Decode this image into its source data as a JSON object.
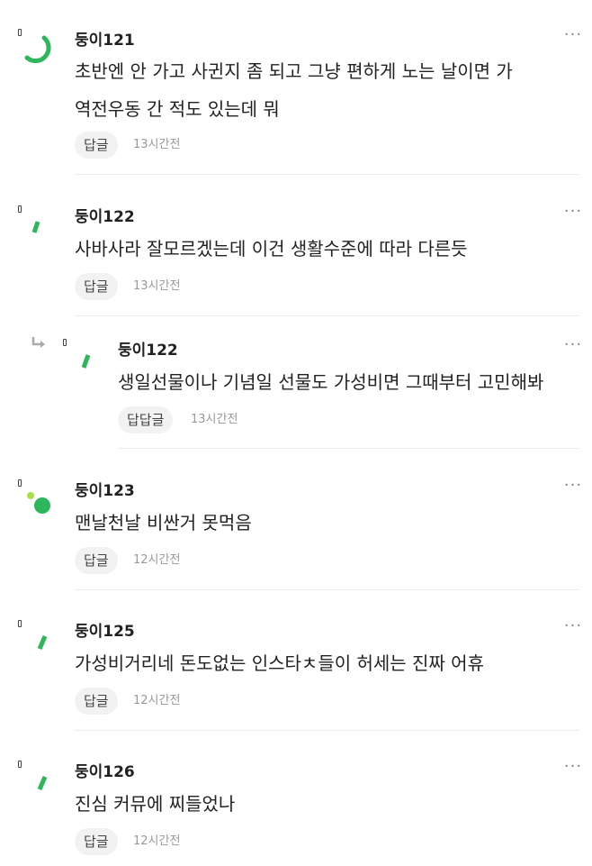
{
  "comments": [
    {
      "author": "둥이121",
      "text_lines": [
        "초반엔 안 가고 사귄지 좀 되고 그냥 편하게 노는 날이면 가",
        "역전우동 간 적도 있는데 뭐"
      ],
      "reply_label": "답글",
      "time": "13시간전",
      "avatar_icon": "green-arc-icon",
      "more_icon": "more-dots-icon"
    },
    {
      "author": "둥이122",
      "text_lines": [
        "사바사라 잘모르겠는데 이건 생활수준에 따라 다른듯"
      ],
      "reply_label": "답글",
      "time": "13시간전",
      "avatar_icon": "green-stroke-icon",
      "more_icon": "more-dots-icon"
    },
    {
      "author": "둥이122",
      "text_lines": [
        "생일선물이나 기념일 선물도 가성비면 그때부터 고민해봐"
      ],
      "reply_label": "답답글",
      "time": "13시간전",
      "avatar_icon": "green-stroke-icon",
      "more_icon": "more-dots-icon",
      "is_reply": true
    },
    {
      "author": "둥이123",
      "text_lines": [
        "맨날천날 비싼거 못먹음"
      ],
      "reply_label": "답글",
      "time": "12시간전",
      "avatar_icon": "green-dots-icon",
      "more_icon": "more-dots-icon"
    },
    {
      "author": "둥이125",
      "text_lines": [
        "가성비거리네 돈도없는 인스타ㅊ들이 허세는 진짜 어휴"
      ],
      "reply_label": "답글",
      "time": "12시간전",
      "avatar_icon": "green-stroke-icon",
      "more_icon": "more-dots-icon"
    },
    {
      "author": "둥이126",
      "text_lines": [
        "진심 커뮤에 찌들었나"
      ],
      "reply_label": "답글",
      "time": "12시간전",
      "avatar_icon": "green-stroke-icon",
      "more_icon": "more-dots-icon"
    }
  ],
  "colors": {
    "accent_green": "#2eb65d",
    "light_green": "#a8e04a",
    "more_gray": "#888888",
    "time_gray": "#999999",
    "button_bg": "#f2f2f2"
  },
  "more_glyph": "···"
}
